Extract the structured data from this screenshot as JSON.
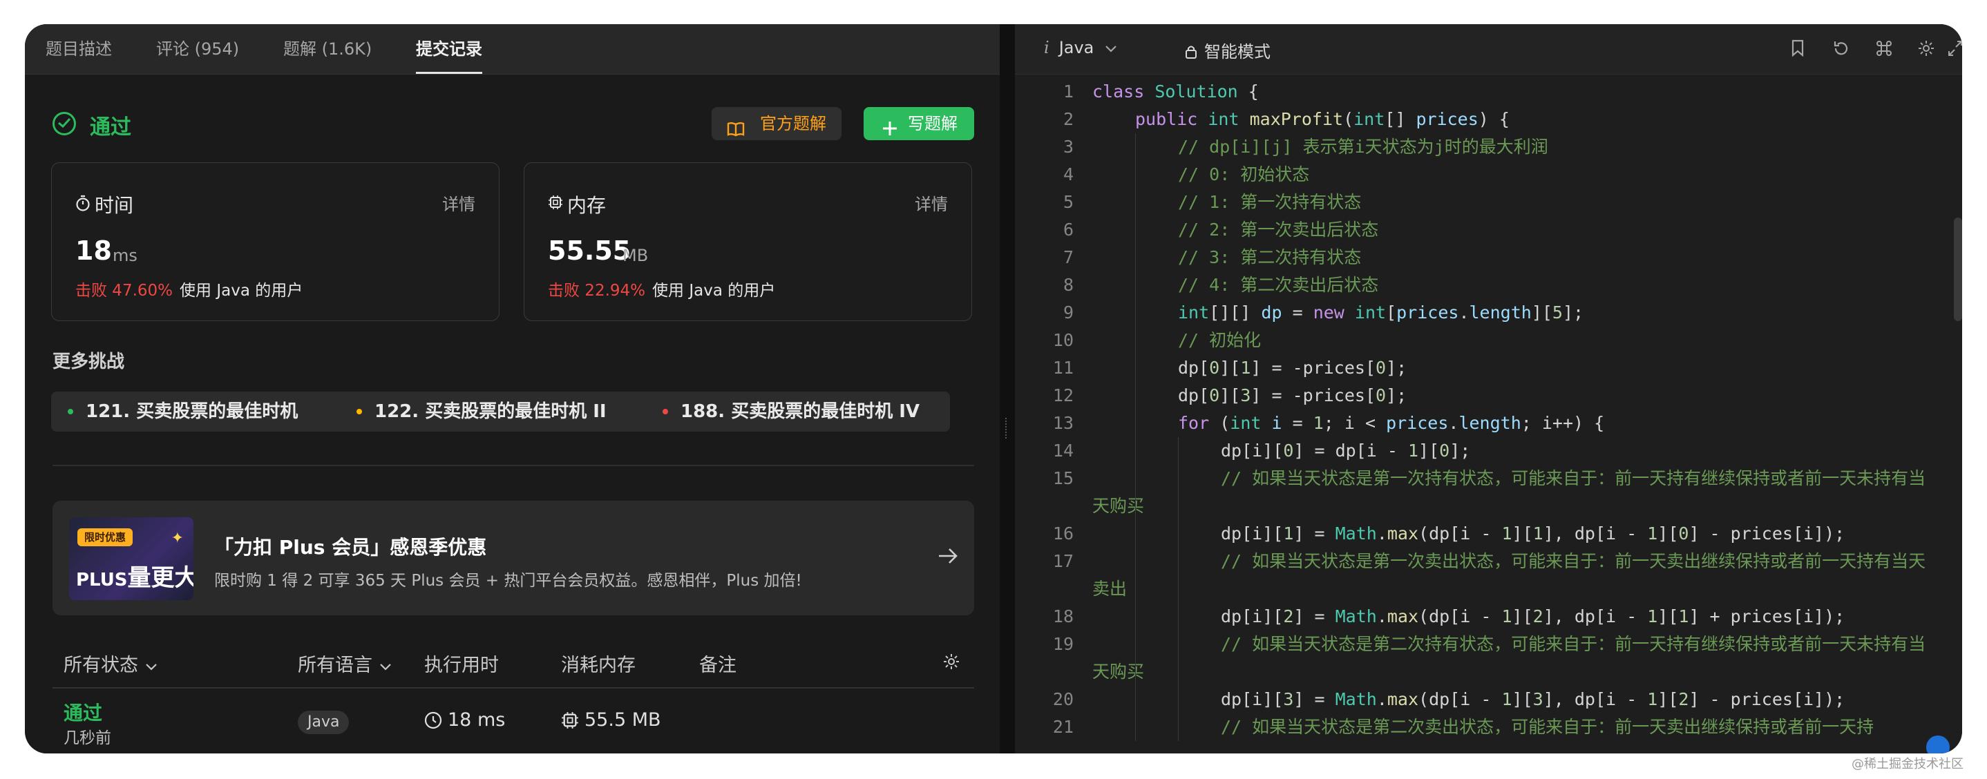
{
  "tabs": [
    {
      "label": "题目描述"
    },
    {
      "label": "评论 (954)"
    },
    {
      "label": "题解 (1.6K)"
    },
    {
      "label": "提交记录"
    }
  ],
  "status": {
    "label": "通过"
  },
  "buttons": {
    "official": "官方题解",
    "write": "写题解"
  },
  "cards": {
    "time": {
      "title": "时间",
      "detail": "详情",
      "value": "18",
      "unit": "ms",
      "beat": "击败 47.60%",
      "suffix": "使用 Java 的用户"
    },
    "memory": {
      "title": "内存",
      "detail": "详情",
      "value": "55.55",
      "unit": "MB",
      "beat": "击败 22.94%",
      "suffix": "使用 Java 的用户"
    }
  },
  "more": {
    "title": "更多挑战",
    "chips": [
      {
        "label": "121. 买卖股票的最佳时机",
        "color": "#2cbb5d"
      },
      {
        "label": "122. 买卖股票的最佳时机 II",
        "color": "#ffb800"
      },
      {
        "label": "188. 买卖股票的最佳时机 IV",
        "color": "#ef4743"
      }
    ]
  },
  "banner": {
    "tag": "限时优惠",
    "img_text_a": "PLUS",
    "img_text_b": "量更大",
    "title": "「力扣 Plus 会员」感恩季优惠",
    "subtitle": "限时购 1 得 2 可享 365 天 Plus 会员 + 热门平台会员权益。感恩相伴，Plus 加倍!"
  },
  "table": {
    "headers": {
      "status": "所有状态",
      "lang": "所有语言",
      "runtime": "执行用时",
      "memory": "消耗内存",
      "note": "备注"
    },
    "row": {
      "status": "通过",
      "time": "几秒前",
      "lang": "Java",
      "runtime": "18 ms",
      "memory": "55.5 MB"
    }
  },
  "editor": {
    "language": "Java",
    "mode": "智能模式",
    "lines": [
      {
        "n": "1",
        "indent": 0,
        "html": "<span class='kw'>class</span> <span class='ty'>Solution</span> {"
      },
      {
        "n": "2",
        "indent": 1,
        "html": "<span class='kw'>public</span> <span class='ty'>int</span> <span class='fn'>maxProfit</span>(<span class='ty'>int</span>[] <span class='va'>prices</span>) {"
      },
      {
        "n": "3",
        "indent": 2,
        "html": "<span class='cm'>// dp[i][j] 表示第i天状态为j时的最大利润</span>"
      },
      {
        "n": "4",
        "indent": 2,
        "html": "<span class='cm'>// 0: 初始状态</span>"
      },
      {
        "n": "5",
        "indent": 2,
        "html": "<span class='cm'>// 1: 第一次持有状态</span>"
      },
      {
        "n": "6",
        "indent": 2,
        "html": "<span class='cm'>// 2: 第一次卖出后状态</span>"
      },
      {
        "n": "7",
        "indent": 2,
        "html": "<span class='cm'>// 3: 第二次持有状态</span>"
      },
      {
        "n": "8",
        "indent": 2,
        "html": "<span class='cm'>// 4: 第二次卖出后状态</span>"
      },
      {
        "n": "9",
        "indent": 2,
        "html": "<span class='ty'>int</span>[][] <span class='va'>dp</span> = <span class='kw'>new</span> <span class='ty'>int</span>[<span class='va'>prices</span>.<span class='va'>length</span>][<span class='nu'>5</span>];"
      },
      {
        "n": "10",
        "indent": 2,
        "html": "<span class='cm'>// 初始化</span>"
      },
      {
        "n": "11",
        "indent": 2,
        "html": "dp[<span class='nu'>0</span>][<span class='nu'>1</span>] = -prices[<span class='nu'>0</span>];"
      },
      {
        "n": "12",
        "indent": 2,
        "html": "dp[<span class='nu'>0</span>][<span class='nu'>3</span>] = -prices[<span class='nu'>0</span>];"
      },
      {
        "n": "13",
        "indent": 2,
        "html": "<span class='kw'>for</span> (<span class='ty'>int</span> <span class='va'>i</span> = <span class='nu'>1</span>; i &lt; <span class='va'>prices</span>.<span class='va'>length</span>; i++) {"
      },
      {
        "n": "14",
        "indent": 3,
        "html": "dp[i][<span class='nu'>0</span>] = dp[i - <span class='nu'>1</span>][<span class='nu'>0</span>];"
      },
      {
        "n": "15",
        "indent": 3,
        "html": "<span class='cm'>// 如果当天状态是第一次持有状态，可能来自于：前一天持有继续保持或者前一天未持有当</span>"
      },
      {
        "n": "",
        "indent": 0,
        "html": "<span class='cm'>天购买</span>"
      },
      {
        "n": "16",
        "indent": 3,
        "html": "dp[i][<span class='nu'>1</span>] = <span class='ty'>Math</span>.<span class='fn'>max</span>(dp[i - <span class='nu'>1</span>][<span class='nu'>1</span>], dp[i - <span class='nu'>1</span>][<span class='nu'>0</span>] - prices[i]);"
      },
      {
        "n": "17",
        "indent": 3,
        "html": "<span class='cm'>// 如果当天状态是第一次卖出状态，可能来自于：前一天卖出继续保持或者前一天持有当天</span>"
      },
      {
        "n": "",
        "indent": 0,
        "html": "<span class='cm'>卖出</span>"
      },
      {
        "n": "18",
        "indent": 3,
        "html": "dp[i][<span class='nu'>2</span>] = <span class='ty'>Math</span>.<span class='fn'>max</span>(dp[i - <span class='nu'>1</span>][<span class='nu'>2</span>], dp[i - <span class='nu'>1</span>][<span class='nu'>1</span>] + prices[i]);"
      },
      {
        "n": "19",
        "indent": 3,
        "html": "<span class='cm'>// 如果当天状态是第二次持有状态，可能来自于：前一天持有继续保持或者前一天未持有当</span>"
      },
      {
        "n": "",
        "indent": 0,
        "html": "<span class='cm'>天购买</span>"
      },
      {
        "n": "20",
        "indent": 3,
        "html": "dp[i][<span class='nu'>3</span>] = <span class='ty'>Math</span>.<span class='fn'>max</span>(dp[i - <span class='nu'>1</span>][<span class='nu'>3</span>], dp[i - <span class='nu'>1</span>][<span class='nu'>2</span>] - prices[i]);"
      },
      {
        "n": "21",
        "indent": 3,
        "html": "<span class='cm'>// 如果当天状态是第二次卖出状态，可能来自于：前一天卖出继续保持或者前一天持</span>"
      }
    ]
  },
  "watermark": "@稀土掘金技术社区"
}
